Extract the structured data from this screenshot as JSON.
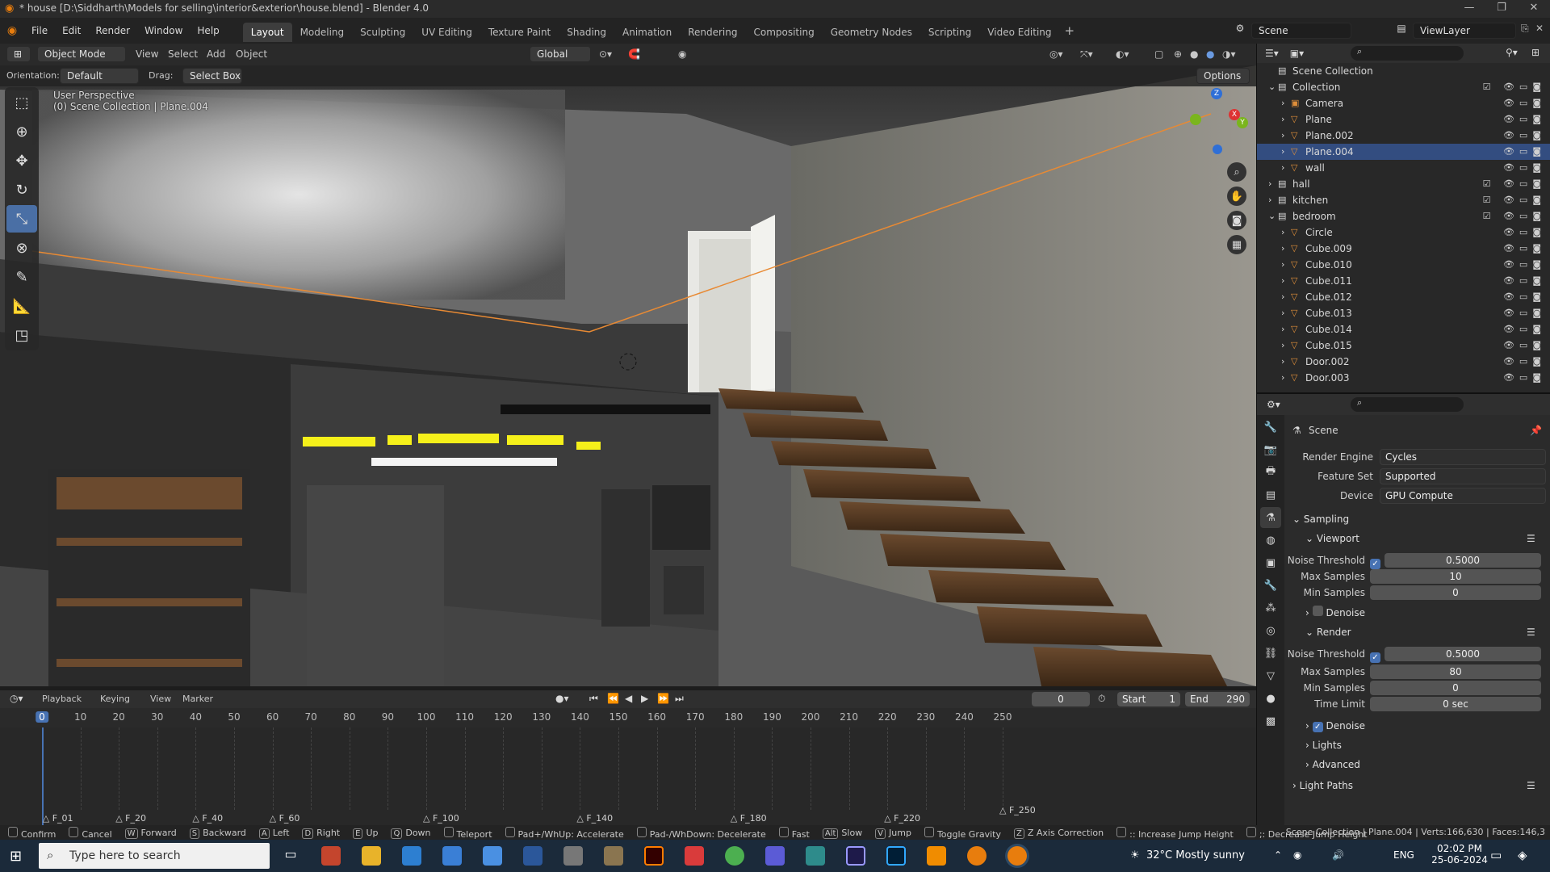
{
  "titlebar": {
    "title": "* house [D:\\Siddharth\\Models for selling\\interior&exterior\\house.blend] - Blender 4.0"
  },
  "menu": [
    "File",
    "Edit",
    "Render",
    "Window",
    "Help"
  ],
  "workspaces": [
    "Layout",
    "Modeling",
    "Sculpting",
    "UV Editing",
    "Texture Paint",
    "Shading",
    "Animation",
    "Rendering",
    "Compositing",
    "Geometry Nodes",
    "Scripting",
    "Video Editing"
  ],
  "active_workspace": "Layout",
  "scene_name": "Scene",
  "view_layer": "ViewLayer",
  "viewport_header": {
    "mode": "Object Mode",
    "view": "View",
    "select": "Select",
    "add": "Add",
    "object": "Object",
    "transform": "Global",
    "options": "Options"
  },
  "tool_options": {
    "orientation_label": "Orientation:",
    "orientation_value": "Default",
    "drag_label": "Drag:",
    "drag_value": "Select Box"
  },
  "viewport_info": {
    "line1": "User Perspective",
    "line2": "(0) Scene Collection | Plane.004"
  },
  "outliner": {
    "root": "Scene Collection",
    "rows": [
      {
        "label": "Collection",
        "level": 1,
        "type": "collection"
      },
      {
        "label": "Camera",
        "level": 2,
        "type": "camera"
      },
      {
        "label": "Plane",
        "level": 2,
        "type": "mesh"
      },
      {
        "label": "Plane.002",
        "level": 2,
        "type": "mesh"
      },
      {
        "label": "Plane.004",
        "level": 2,
        "type": "mesh",
        "selected": true
      },
      {
        "label": "wall",
        "level": 2,
        "type": "mesh"
      },
      {
        "label": "hall",
        "level": 1,
        "type": "collection"
      },
      {
        "label": "kitchen",
        "level": 1,
        "type": "collection"
      },
      {
        "label": "bedroom",
        "level": 1,
        "type": "collection"
      },
      {
        "label": "Circle",
        "level": 2,
        "type": "mesh"
      },
      {
        "label": "Cube.009",
        "level": 2,
        "type": "mesh"
      },
      {
        "label": "Cube.010",
        "level": 2,
        "type": "mesh"
      },
      {
        "label": "Cube.011",
        "level": 2,
        "type": "mesh"
      },
      {
        "label": "Cube.012",
        "level": 2,
        "type": "mesh"
      },
      {
        "label": "Cube.013",
        "level": 2,
        "type": "mesh"
      },
      {
        "label": "Cube.014",
        "level": 2,
        "type": "mesh"
      },
      {
        "label": "Cube.015",
        "level": 2,
        "type": "mesh"
      },
      {
        "label": "Door.002",
        "level": 2,
        "type": "mesh"
      },
      {
        "label": "Door.003",
        "level": 2,
        "type": "mesh"
      }
    ]
  },
  "properties": {
    "context": "Scene",
    "render_engine_label": "Render Engine",
    "render_engine": "Cycles",
    "feature_set_label": "Feature Set",
    "feature_set": "Supported",
    "device_label": "Device",
    "device": "GPU Compute",
    "sampling": "Sampling",
    "viewport": "Viewport",
    "noise_threshold_label": "Noise Threshold",
    "vp_noise_threshold": "0.5000",
    "max_samples_label": "Max Samples",
    "vp_max_samples": "10",
    "min_samples_label": "Min Samples",
    "vp_min_samples": "0",
    "denoise": "Denoise",
    "render": "Render",
    "r_noise_threshold": "0.5000",
    "r_max_samples": "80",
    "r_min_samples": "0",
    "time_limit_label": "Time Limit",
    "time_limit": "0 sec",
    "lights": "Lights",
    "advanced": "Advanced",
    "light_paths": "Light Paths"
  },
  "timeline": {
    "playback": "Playback",
    "keying": "Keying",
    "view": "View",
    "marker": "Marker",
    "current_frame": "0",
    "start_label": "Start",
    "start": "1",
    "end_label": "End",
    "end": "290",
    "ticks": [
      "0",
      "10",
      "20",
      "30",
      "40",
      "50",
      "60",
      "70",
      "80",
      "90",
      "100",
      "110",
      "120",
      "130",
      "140",
      "150",
      "160",
      "170",
      "180",
      "190",
      "200",
      "210",
      "220",
      "230",
      "240",
      "250"
    ],
    "markers": [
      "F_01",
      "F_20",
      "F_40",
      "F_60",
      "F_100",
      "F_140",
      "F_180",
      "F_220",
      "F_250"
    ]
  },
  "statusbar": {
    "items": [
      "Confirm",
      "Cancel",
      "Forward",
      "Backward",
      "Left",
      "Right",
      "Up",
      "Down",
      "Teleport",
      "Pad+/WhUp: Accelerate",
      "Pad-/WhDown: Decelerate",
      "Fast",
      "Slow",
      "Jump",
      "Toggle Gravity",
      "Z Axis Correction",
      ":: Increase Jump Height",
      ";: Decrease Jump Height"
    ],
    "keys": [
      "",
      "",
      "W",
      "S",
      "A",
      "D",
      "E",
      "Q",
      "",
      "",
      "",
      "",
      "Alt",
      "V",
      "",
      "Z",
      "",
      ""
    ],
    "info": "Scene Collection | Plane.004 | Verts:166,630 | Faces:146,3"
  },
  "taskbar": {
    "search_placeholder": "Type here to search",
    "weather": "32°C  Mostly sunny",
    "lang": "ENG",
    "time": "02:02 PM",
    "date": "25-06-2024"
  }
}
